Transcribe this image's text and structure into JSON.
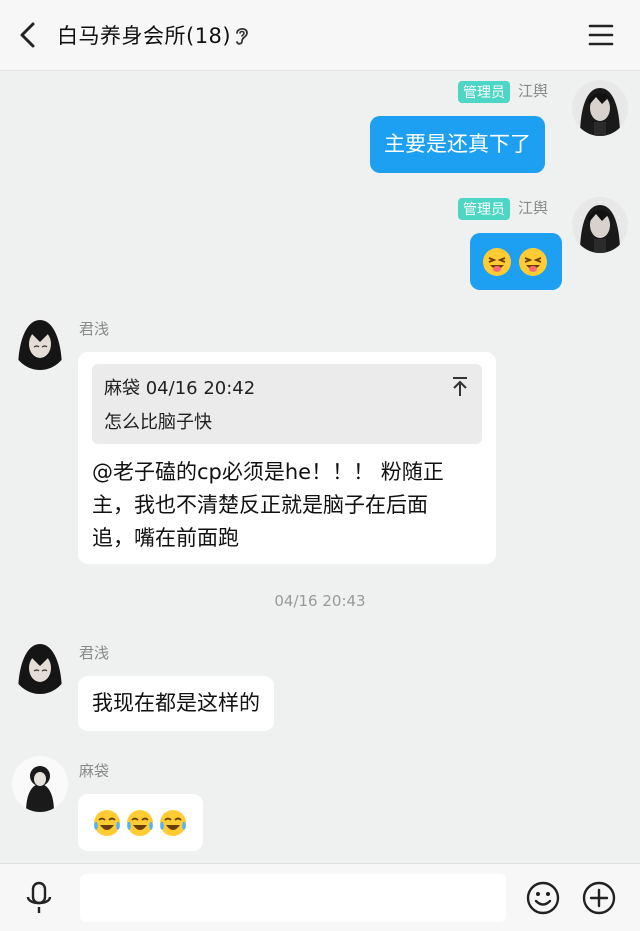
{
  "header": {
    "title": "白马养身会所(18)",
    "back_icon": "chevron-left-icon",
    "ear_icon": "ear-icon",
    "menu_icon": "hamburger-menu-icon"
  },
  "messages": [
    {
      "sender": "江舆",
      "badge": "管理员",
      "direction": "out",
      "text": "主要是还真下了"
    },
    {
      "sender": "江舆",
      "badge": "管理员",
      "direction": "out",
      "emoji": [
        "squinting-tongue-emoji",
        "squinting-tongue-emoji"
      ]
    },
    {
      "sender": "君浅",
      "direction": "in",
      "quote": {
        "author_time": "麻袋 04/16 20:42",
        "text": "怎么比脑子快"
      },
      "text_line1": "@老子磕的cp必须是he！！！ 粉随正",
      "text_line2": "主，我也不清楚反正就是脑子在后面",
      "text_line3": "追，嘴在前面跑"
    },
    {
      "sender": "君浅",
      "direction": "in",
      "text": "我现在都是这样的"
    },
    {
      "sender": "麻袋",
      "direction": "in",
      "emoji": [
        "tears-of-joy-emoji",
        "tears-of-joy-emoji",
        "tears-of-joy-emoji"
      ]
    }
  ],
  "time_separator": "04/16 20:43",
  "input": {
    "placeholder": "",
    "value": ""
  },
  "colors": {
    "outgoing_bubble": "#1ea0f2",
    "admin_badge": "#4ed6c4",
    "background": "#eef1ef"
  }
}
